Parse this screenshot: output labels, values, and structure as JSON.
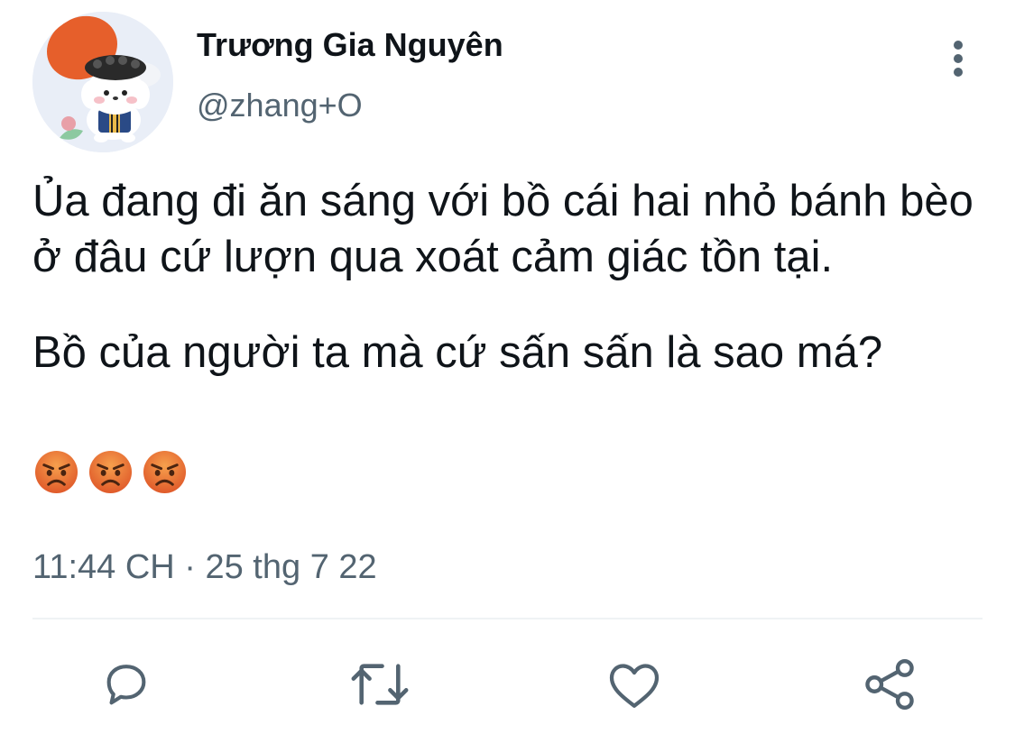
{
  "tweet": {
    "author": {
      "display_name": "Trương Gia Nguyên",
      "handle": "@zhang+O",
      "avatar_icon": "avatar-cartoon-icon"
    },
    "text": {
      "paragraph_1": "Ủa đang đi ăn sáng với bồ cái hai nhỏ bánh bèo ở đâu cứ lượn qua xoát cảm giác tồn tại.",
      "paragraph_2": "Bồ của người ta mà cứ sấn sấn là sao má?",
      "emojis": [
        "angry-face-icon",
        "angry-face-icon",
        "angry-face-icon"
      ]
    },
    "timestamp": "11:44 CH · 25 thg 7 22",
    "actions": [
      "reply-icon",
      "retweet-icon",
      "like-icon",
      "share-icon"
    ]
  },
  "colors": {
    "text_primary": "#0f1419",
    "text_secondary": "#536471",
    "divider": "#eff3f4",
    "action_icon": "#536471"
  }
}
